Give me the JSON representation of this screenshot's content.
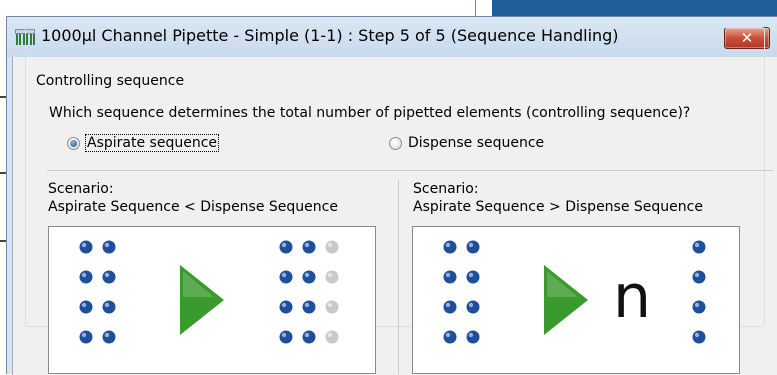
{
  "window": {
    "title": "1000µl Channel Pipette - Simple (1-1) : Step 5 of 5 (Sequence Handling)",
    "close_glyph": "✕"
  },
  "group": {
    "title": "Controlling sequence",
    "question": "Which sequence determines the total number of pipetted elements (controlling sequence)?"
  },
  "options": [
    {
      "label": "Aspirate sequence",
      "selected": true
    },
    {
      "label": "Dispense sequence",
      "selected": false
    }
  ],
  "scenarios": [
    {
      "heading": "Scenario:",
      "description": "Aspirate Sequence < Dispense Sequence",
      "source_wells": [
        "filled",
        "filled",
        "filled",
        "filled",
        "filled",
        "filled",
        "filled",
        "filled"
      ],
      "target_wells": [
        "filled",
        "filled",
        "empty",
        "filled",
        "filled",
        "empty",
        "filled",
        "filled",
        "empty",
        "filled",
        "filled",
        "empty"
      ],
      "marker": ""
    },
    {
      "heading": "Scenario:",
      "description": "Aspirate Sequence > Dispense Sequence",
      "source_wells": [
        "filled",
        "filled",
        "filled",
        "filled",
        "filled",
        "filled",
        "filled",
        "filled"
      ],
      "target_wells": [
        "filled",
        "filled",
        "filled",
        "filled"
      ],
      "marker": "n"
    }
  ],
  "colors": {
    "well_filled": "#1f4f9c",
    "well_empty": "#c9c9c9",
    "arrow": "#3a9a2e",
    "titlebar": "#d6e3f1",
    "close_button": "#c9503a"
  },
  "icons": {
    "app": "pipette-channels-icon",
    "close": "close-icon",
    "arrow": "play-arrow-icon"
  }
}
